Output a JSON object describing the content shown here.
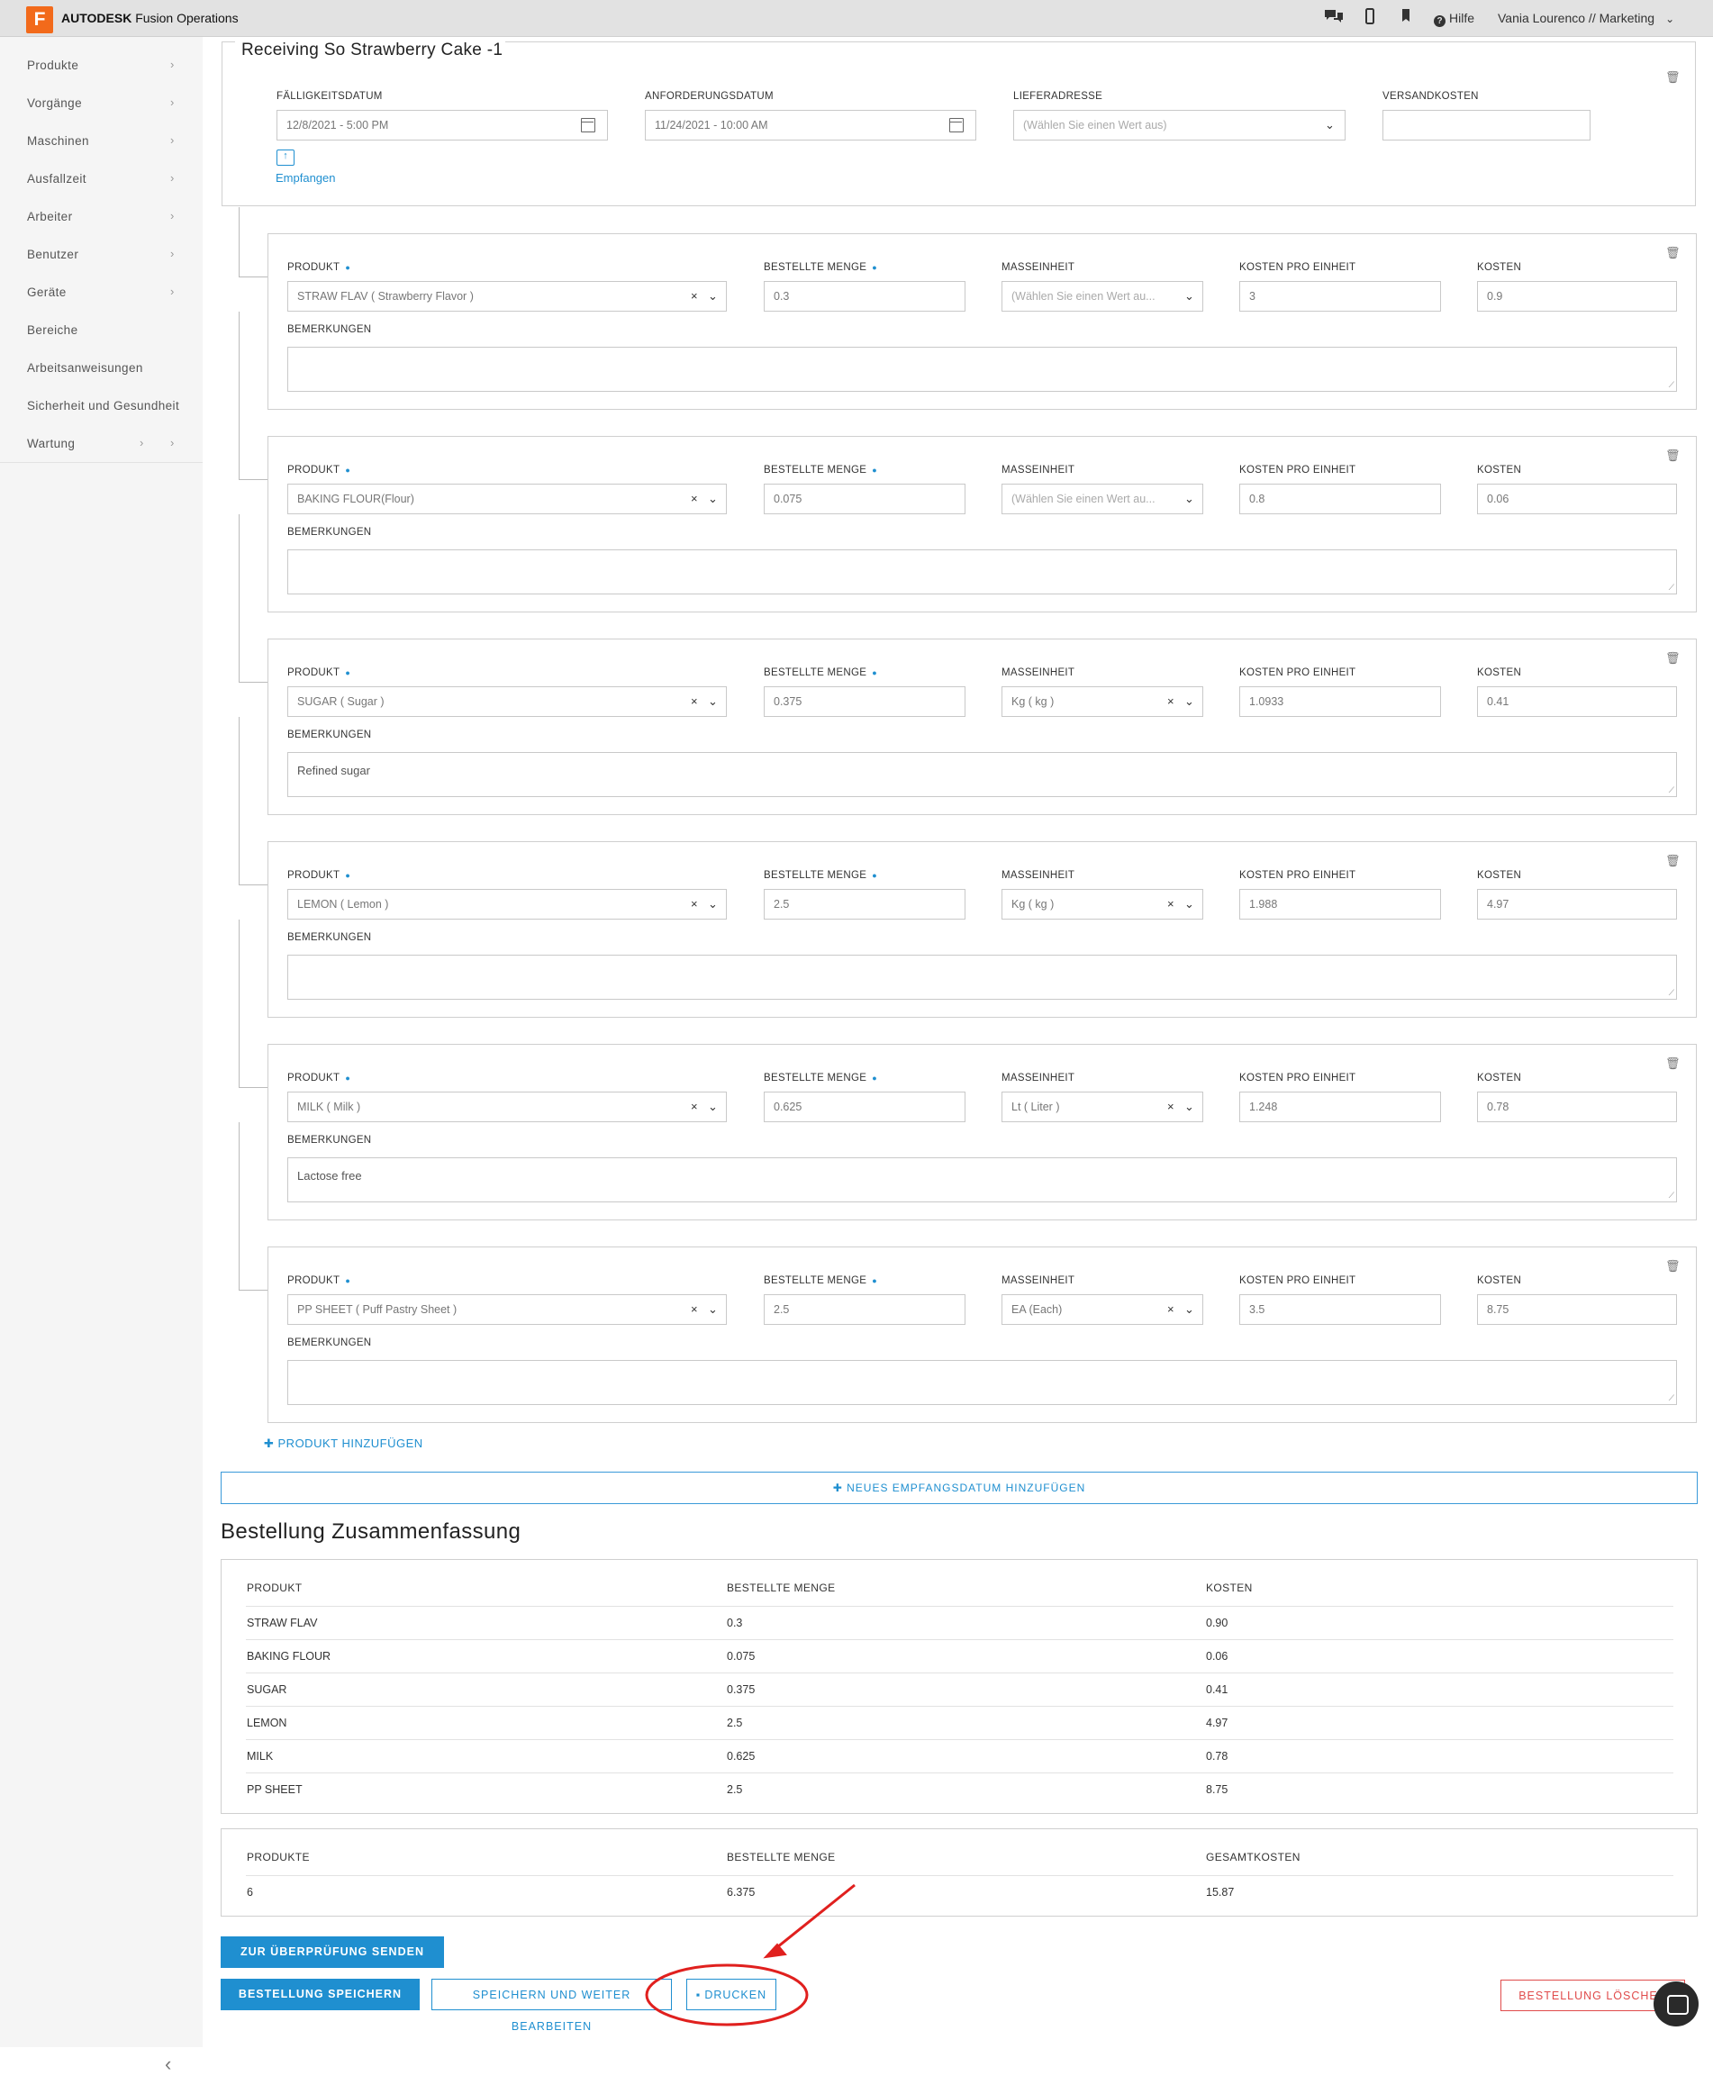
{
  "header": {
    "logo_letter": "F",
    "brand_bold": "AUTODESK",
    "brand_rest": " Fusion Operations",
    "chat_icon": "chat-icon",
    "mobile_icon": "mobile-icon",
    "bookmark_icon": "bookmark-icon",
    "help_label": "Hilfe",
    "user_label": "Vania Lourenco // Marketing"
  },
  "sidebar": {
    "items": [
      {
        "label": "Produkte"
      },
      {
        "label": "Vorgänge"
      },
      {
        "label": "Maschinen"
      },
      {
        "label": "Ausfallzeit"
      },
      {
        "label": "Arbeiter"
      },
      {
        "label": "Benutzer"
      },
      {
        "label": "Geräte"
      },
      {
        "label": "Bereiche"
      },
      {
        "label": "Arbeitsanweisungen"
      },
      {
        "label": "Sicherheit und Gesundheit"
      },
      {
        "label": "Wartung"
      }
    ]
  },
  "receiving": {
    "title": "Receiving So Strawberry Cake -1",
    "due_label": "FÄLLIGKEITSDATUM",
    "due_value": "12/8/2021 - 5:00 PM",
    "req_label": "ANFORDERUNGSDATUM",
    "req_value": "11/24/2021 - 10:00 AM",
    "addr_label": "LIEFERADRESSE",
    "addr_placeholder": "(Wählen Sie einen Wert aus)",
    "ship_label": "VERSANDKOSTEN",
    "ship_value": "",
    "receive_label": "Empfangen"
  },
  "labels": {
    "product": "PRODUKT",
    "qty": "BESTELLTE MENGE",
    "unit": "MASSEINHEIT",
    "unit_cost": "KOSTEN PRO EINHEIT",
    "cost": "KOSTEN",
    "remarks": "BEMERKUNGEN"
  },
  "lines": [
    {
      "product": "STRAW FLAV ( Strawberry Flavor )",
      "qty": "0.3",
      "unit": "(Wählen Sie einen Wert au...",
      "unit_ph": true,
      "unit_cost": "3",
      "cost": "0.9",
      "remarks": ""
    },
    {
      "product": "BAKING FLOUR(Flour)",
      "qty": "0.075",
      "unit": "(Wählen Sie einen Wert au...",
      "unit_ph": true,
      "unit_cost": "0.8",
      "cost": "0.06",
      "remarks": ""
    },
    {
      "product": "SUGAR ( Sugar )",
      "qty": "0.375",
      "unit": "Kg ( kg )",
      "unit_ph": false,
      "unit_cost": "1.0933",
      "cost": "0.41",
      "remarks": "Refined sugar"
    },
    {
      "product": "LEMON ( Lemon )",
      "qty": "2.5",
      "unit": "Kg ( kg )",
      "unit_ph": false,
      "unit_cost": "1.988",
      "cost": "4.97",
      "remarks": ""
    },
    {
      "product": "MILK ( Milk )",
      "qty": "0.625",
      "unit": "Lt ( Liter )",
      "unit_ph": false,
      "unit_cost": "1.248",
      "cost": "0.78",
      "remarks": "Lactose free"
    },
    {
      "product": "PP SHEET ( Puff Pastry Sheet )",
      "qty": "2.5",
      "unit": "EA (Each)",
      "unit_ph": false,
      "unit_cost": "3.5",
      "cost": "8.75",
      "remarks": ""
    }
  ],
  "add_product": "✚ PRODUKT HINZUFÜGEN",
  "add_date": "✚ NEUES EMPFANGSDATUM HINZUFÜGEN",
  "summary": {
    "title": "Bestellung Zusammenfassung",
    "headers": [
      "PRODUKT",
      "BESTELLTE MENGE",
      "KOSTEN"
    ],
    "rows": [
      [
        "STRAW FLAV",
        "0.3",
        "0.90"
      ],
      [
        "BAKING FLOUR",
        "0.075",
        "0.06"
      ],
      [
        "SUGAR",
        "0.375",
        "0.41"
      ],
      [
        "LEMON",
        "2.5",
        "4.97"
      ],
      [
        "MILK",
        "0.625",
        "0.78"
      ],
      [
        "PP SHEET",
        "2.5",
        "8.75"
      ]
    ]
  },
  "totals": {
    "headers": [
      "PRODUKTE",
      "BESTELLTE MENGE",
      "GESAMTKOSTEN"
    ],
    "values": [
      "6",
      "6.375",
      "15.87"
    ]
  },
  "actions": {
    "submit_review": "ZUR ÜBERPRÜFUNG SENDEN",
    "save": "BESTELLUNG SPEICHERN",
    "save_continue": "SPEICHERN UND WEITER BEARBEITEN",
    "print": "DRUCKEN",
    "delete": "BESTELLUNG LÖSCHEN"
  },
  "colors": {
    "accent": "#1f8fd0",
    "danger": "#e04b4b",
    "annotation": "#e0201e",
    "logo": "#f26a1b"
  }
}
